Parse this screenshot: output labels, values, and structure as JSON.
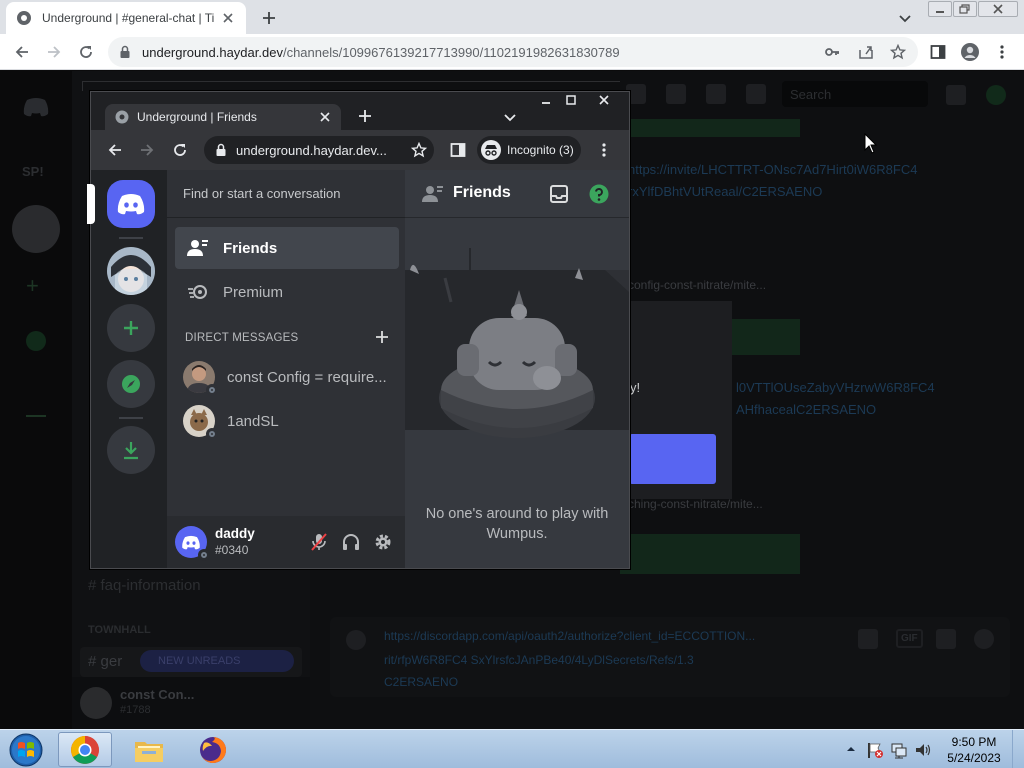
{
  "browser": {
    "tab_title": "Underground | #general-chat | Ti",
    "url_host": "underground.haydar.dev",
    "url_path": "/channels/1099676139217713990/1102191982631830789"
  },
  "background_page": {
    "server_abbrev": "SP!",
    "search_placeholder": "Search",
    "link_line_1": "https://invite/LHCTTRT-ONsc7Ad7Hirt0iW6R8FC4",
    "link_line_2": "rxYlfDBhtVUtReaal/C2ERSAENO",
    "config_line_1": "config-const-nitrate/mite...",
    "modal_text": "y!",
    "link_line_3": "l0VTTlOUseZabyVHzrwW6R8FC4",
    "link_line_4": "AHfhacealC2ERSAENO",
    "config_line_2": "ching-const-nitrate/mite...",
    "channel_faq": "faq-information",
    "category": "TOWNHALL",
    "channel_gen": "ger",
    "new_unreads": "NEW UNREADS",
    "bottom_user": "const Con...",
    "bottom_tag": "#1788",
    "composer_link_1": "https://discordapp.com/api/oauth2/authorize?client_id=ECCOTTION...",
    "composer_link_2": "rit/rfpW6R8FC4 SxYlrsfcJAnPBe40/4LyDlSecrets/Refs/1.3",
    "composer_link_3": "C2ERSAENO",
    "gif_label": "GIF"
  },
  "popup": {
    "tab_title": "Underground | Friends",
    "url": "underground.haydar.dev...",
    "incognito_label": "Incognito (3)",
    "search_placeholder": "Find or start a conversation",
    "nav": [
      {
        "label": "Friends",
        "icon": "friends-icon",
        "active": true
      },
      {
        "label": "Premium",
        "icon": "nitro-icon",
        "active": false
      }
    ],
    "dm_header": "DIRECT MESSAGES",
    "dms": [
      {
        "name": "const Config = require..."
      },
      {
        "name": "1andSL"
      }
    ],
    "user": {
      "name": "daddy",
      "tag": "#0340"
    },
    "main_title": "Friends",
    "empty_text": "No one's around to play with Wumpus."
  },
  "taskbar": {
    "time": "9:50 PM",
    "date": "5/24/2023"
  },
  "colors": {
    "blurple": "#5865f2",
    "discord_green": "#3ba55d",
    "incognito_bg": "#35363a"
  }
}
